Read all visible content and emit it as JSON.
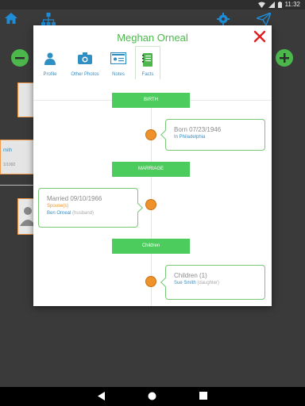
{
  "status_bar": {
    "time": "11:32"
  },
  "modal": {
    "title": "Meghan Orneal",
    "tabs": [
      {
        "label": "Profile",
        "icon": "person-icon"
      },
      {
        "label": "Other Photos",
        "icon": "camera-icon"
      },
      {
        "label": "Notes",
        "icon": "id-card-icon"
      },
      {
        "label": "Facts",
        "icon": "notebook-icon",
        "active": true
      }
    ],
    "sections": {
      "birth": "BIRTH",
      "marriage": "MARRIAGE",
      "children": "Children"
    },
    "birth_event": {
      "date": "Born 07/23/1946",
      "place": "In Philadelphia"
    },
    "marriage_event": {
      "date": "Married 09/10/1966",
      "spouse_label": "Spouse(s)",
      "spouse_name": "Ben Orneal",
      "spouse_role": "(husband)"
    },
    "children_event": {
      "title": "Children (1)",
      "child_name": "Sue Smith",
      "child_role": "(daughter)"
    }
  },
  "background": {
    "card_label": "mith",
    "card_sub": "1/1992"
  },
  "colors": {
    "accent_green": "#4cb84c",
    "orange": "#f0922a",
    "blue_link": "#3b8fc2",
    "close_red": "#e02020"
  }
}
